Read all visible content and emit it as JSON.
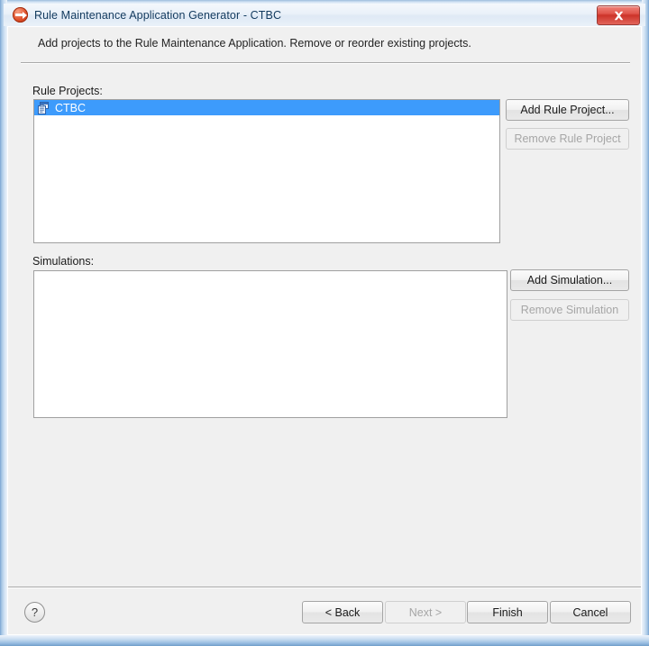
{
  "window": {
    "title": "Rule Maintenance Application Generator - CTBC",
    "app_icon": "red-arrow-icon",
    "close_label": "Close",
    "close_icon": "close-icon"
  },
  "header": {
    "description": "Add projects to the Rule Maintenance Application. Remove or reorder existing projects."
  },
  "rule_projects": {
    "label": "Rule Projects:",
    "items": [
      {
        "name": "CTBC",
        "icon": "project-icon",
        "selected": true
      }
    ],
    "add_button": "Add Rule Project...",
    "remove_button": "Remove Rule Project",
    "remove_enabled": false
  },
  "simulations": {
    "label": "Simulations:",
    "items": [],
    "add_button": "Add Simulation...",
    "remove_button": "Remove Simulation",
    "remove_enabled": false
  },
  "footer": {
    "help_label": "?",
    "back_label": "< Back",
    "next_label": "Next >",
    "next_enabled": false,
    "finish_label": "Finish",
    "cancel_label": "Cancel"
  },
  "colors": {
    "selection_blue": "#3d9bfc",
    "dialog_background": "#f0f0f0",
    "frame_blue": "#a9c8e6",
    "close_red": "#cc3228",
    "disabled_text": "#a6a6a6"
  }
}
